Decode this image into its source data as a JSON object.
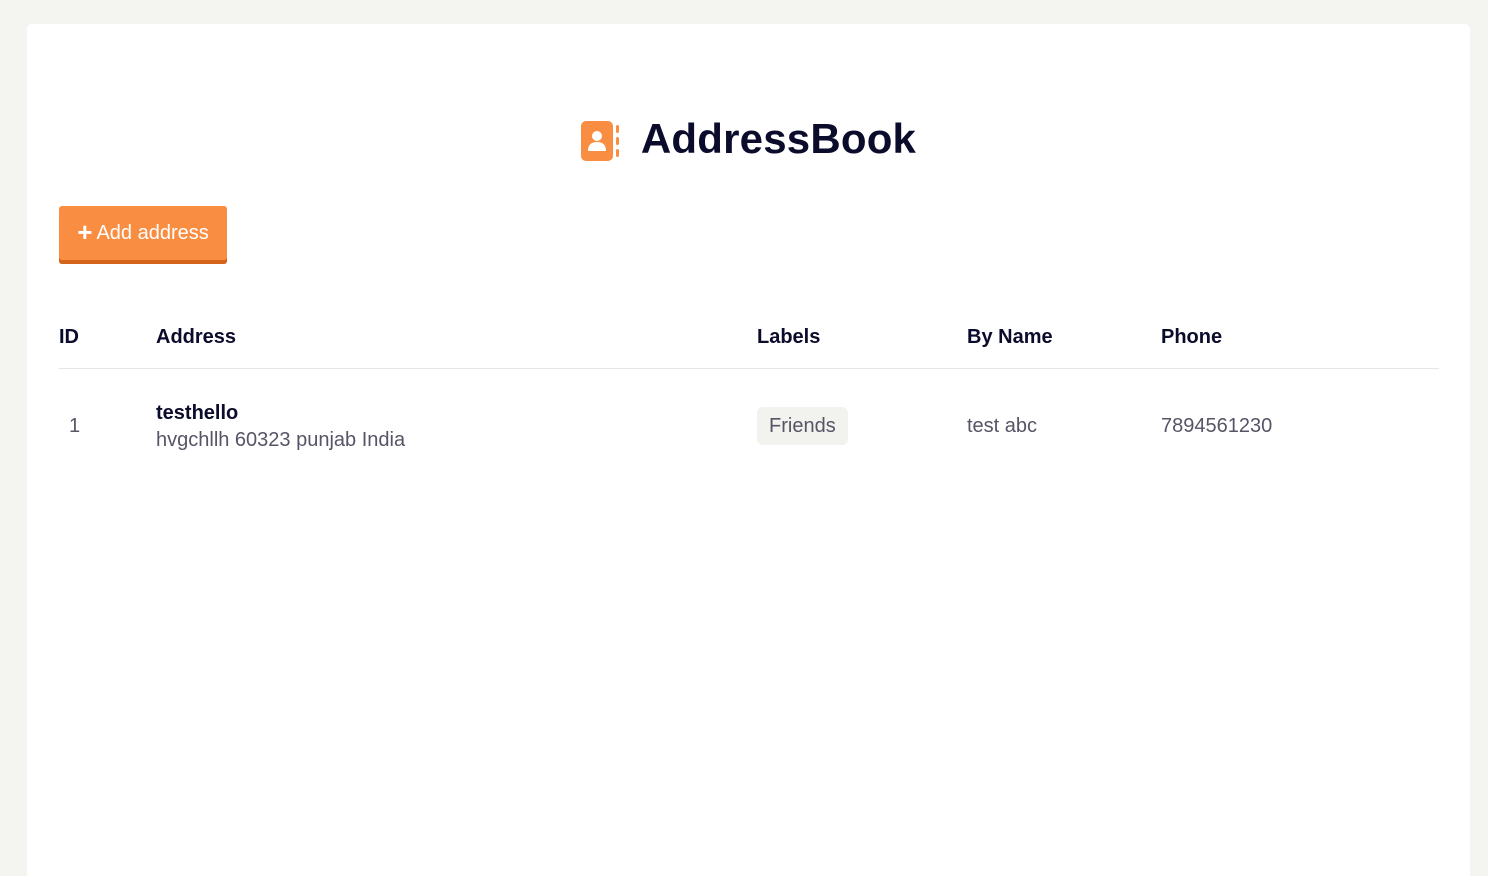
{
  "app": {
    "title": "AddressBook",
    "logo_icon": "address-book-icon",
    "accent_color": "#f98e42"
  },
  "toolbar": {
    "add_label": "Add address",
    "add_icon": "plus-icon"
  },
  "table": {
    "headers": {
      "id": "ID",
      "address": "Address",
      "labels": "Labels",
      "by_name": "By Name",
      "phone": "Phone"
    },
    "rows": [
      {
        "id": "1",
        "address_title": "testhello",
        "address_detail": "hvgchllh 60323 punjab India",
        "label": "Friends",
        "by_name": "test abc",
        "phone": "7894561230"
      }
    ]
  }
}
